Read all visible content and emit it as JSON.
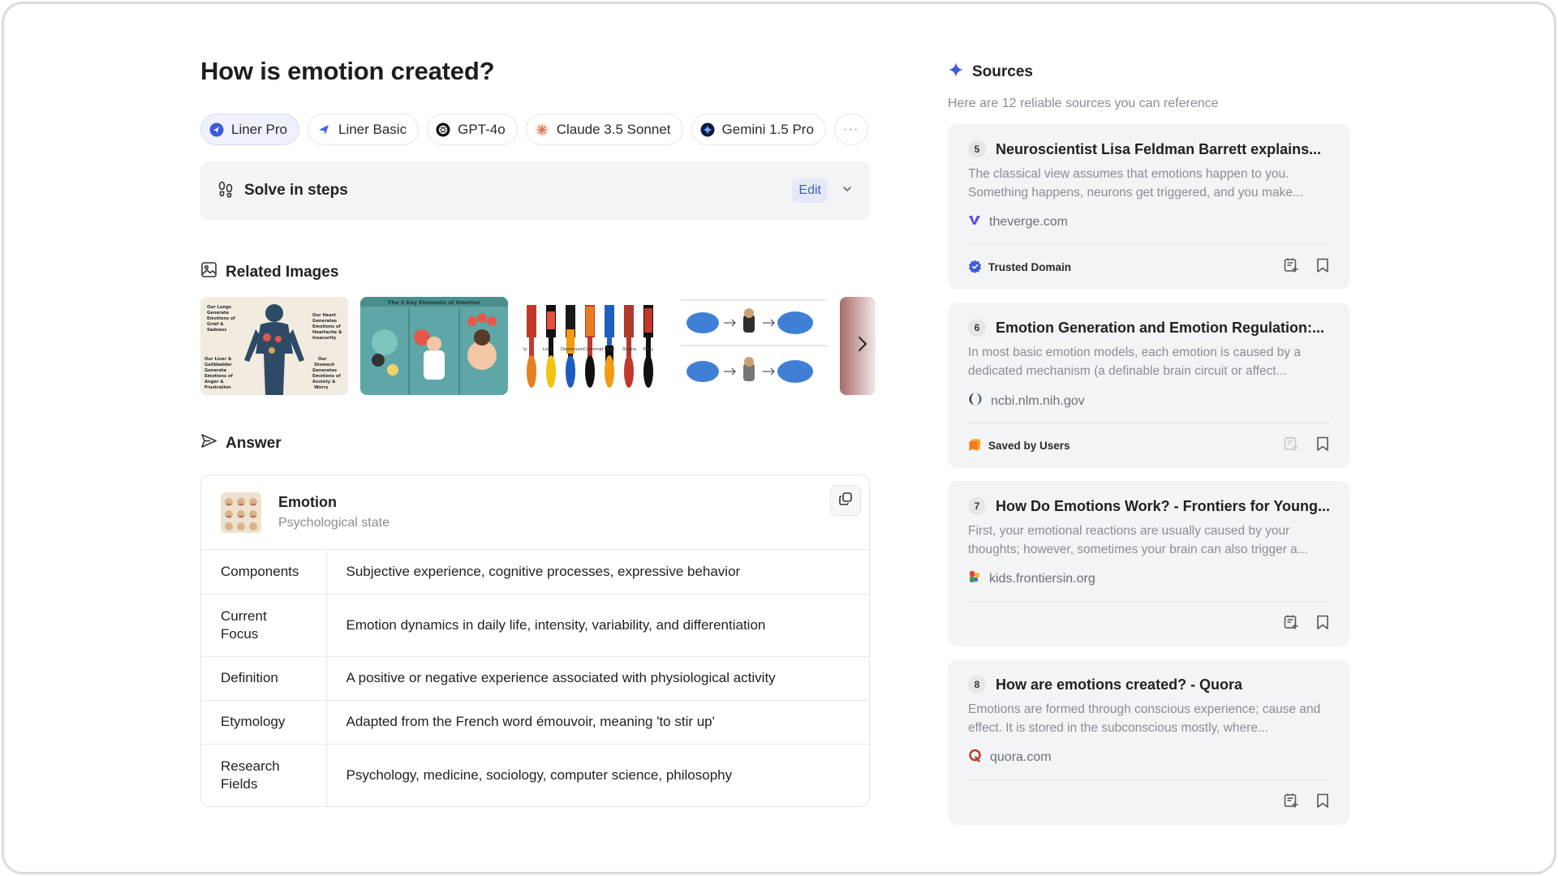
{
  "question": "How is emotion created?",
  "models": [
    {
      "label": "Liner Pro",
      "icon": "liner-pro-icon",
      "active": true
    },
    {
      "label": "Liner Basic",
      "icon": "liner-basic-icon",
      "active": false
    },
    {
      "label": "GPT-4o",
      "icon": "openai-icon",
      "active": false
    },
    {
      "label": "Claude 3.5 Sonnet",
      "icon": "claude-icon",
      "active": false
    },
    {
      "label": "Gemini 1.5 Pro",
      "icon": "gemini-icon",
      "active": false
    }
  ],
  "more_label": "···",
  "solve": {
    "label": "Solve in steps",
    "edit_label": "Edit"
  },
  "related_images": {
    "title": "Related Images",
    "thumb_texts": {
      "t1_left_top": "Our Lungs Generate Emotions of Grief & Sadness",
      "t1_right_top": "Our Heart Generates Emotions of Heartache & Insecurity",
      "t1_left_bottom": "Our Liver & Gallbladder Generate Emotions of Anger & Frustration",
      "t1_right_bottom": "Our Stomach Generates Emotions of Anxiety & Worry",
      "t2_title": "The 3 Key Elements of Emotion"
    }
  },
  "answer": {
    "title": "Answer",
    "entity": {
      "name": "Emotion",
      "subtitle": "Psychological state"
    },
    "rows": [
      {
        "key": "Components",
        "value": "Subjective experience, cognitive processes, expressive behavior"
      },
      {
        "key": "Current Focus",
        "value": "Emotion dynamics in daily life, intensity, variability, and differentiation"
      },
      {
        "key": "Definition",
        "value": "A positive or negative experience associated with physiological activity"
      },
      {
        "key": "Etymology",
        "value": "Adapted from the French word émouvoir, meaning 'to stir up'"
      },
      {
        "key": "Research Fields",
        "value": "Psychology, medicine, sociology, computer science, philosophy"
      }
    ]
  },
  "sources": {
    "title": "Sources",
    "subtitle": "Here are 12 reliable sources you can reference",
    "items": [
      {
        "num": "5",
        "title": "Neuroscientist Lisa Feldman Barrett explains...",
        "desc": "The classical view assumes that emotions happen to you. Something happens, neurons get triggered, and you make...",
        "domain": "theverge.com",
        "badge": "Trusted Domain",
        "badge_icon": "verified-check-icon"
      },
      {
        "num": "6",
        "title": "Emotion Generation and Emotion Regulation:...",
        "desc": "In most basic emotion models, each emotion is caused by a dedicated mechanism (a definable brain circuit or affect...",
        "domain": "ncbi.nlm.nih.gov",
        "badge": "Saved by Users",
        "badge_icon": "saved-bookmark-icon"
      },
      {
        "num": "7",
        "title": "How Do Emotions Work? - Frontiers for Young...",
        "desc": "First, your emotional reactions are usually caused by your thoughts; however, sometimes your brain can also trigger a...",
        "domain": "kids.frontiersin.org",
        "badge": "",
        "badge_icon": ""
      },
      {
        "num": "8",
        "title": "How are emotions created? - Quora",
        "desc": "Emotions are formed through conscious experience; cause and effect. It is stored in the subconscious mostly, where...",
        "domain": "quora.com",
        "badge": "",
        "badge_icon": ""
      }
    ]
  },
  "colors": {
    "accent": "#3d5bd9",
    "text": "#1f2023",
    "muted": "#8a8d96",
    "card_bg": "#f3f4f6"
  }
}
